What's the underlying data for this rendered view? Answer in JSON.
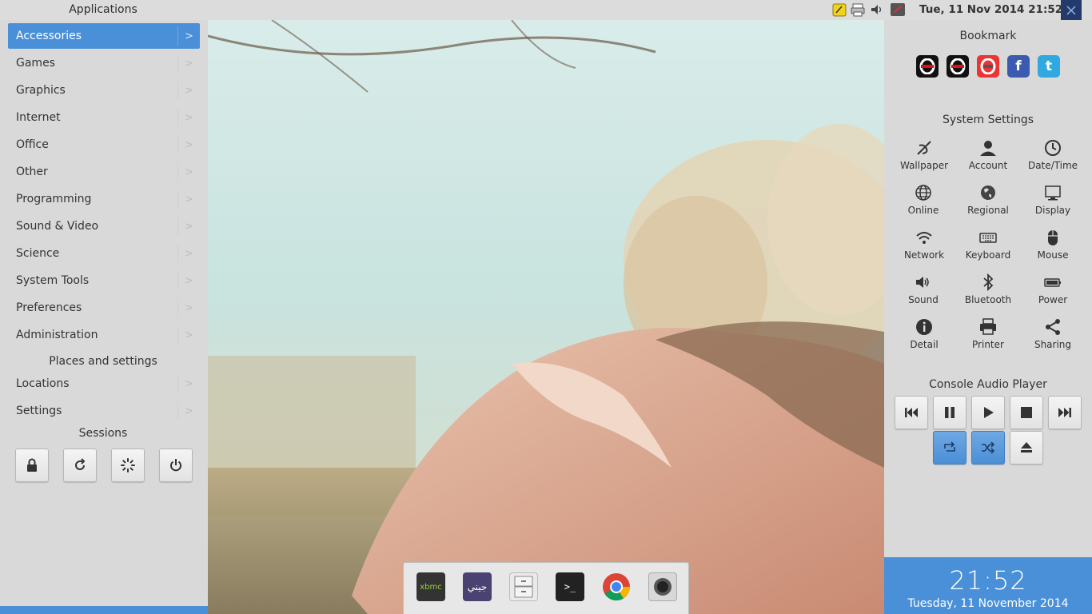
{
  "topbar": {
    "apps_title": "Applications",
    "clock": "Tue, 11 Nov 2014 21:52",
    "tray_icons": [
      "notes-icon",
      "printer-icon",
      "volume-icon",
      "network-icon"
    ]
  },
  "leftmenu": {
    "categories": [
      {
        "label": "Accessories"
      },
      {
        "label": "Games"
      },
      {
        "label": "Graphics"
      },
      {
        "label": "Internet"
      },
      {
        "label": "Office"
      },
      {
        "label": "Other"
      },
      {
        "label": "Programming"
      },
      {
        "label": "Sound & Video"
      },
      {
        "label": "Science"
      },
      {
        "label": "System Tools"
      },
      {
        "label": "Preferences"
      },
      {
        "label": "Administration"
      }
    ],
    "places_title": "Places and settings",
    "places": [
      {
        "label": "Locations"
      },
      {
        "label": "Settings"
      }
    ],
    "sessions_title": "Sessions",
    "sessions": [
      "lock-icon",
      "restart-icon",
      "suspend-icon",
      "power-icon"
    ]
  },
  "dock": {
    "items": [
      "xbmc",
      "arabic-app",
      "file-cabinet",
      "terminal",
      "chrome",
      "camera"
    ],
    "xbmc_label": "xbmc",
    "terminal_label": ">_",
    "arabic_label": "جيني"
  },
  "rightpanel": {
    "bookmark_title": "Bookmark",
    "bookmarks": [
      "opera",
      "opera",
      "opera-alt",
      "facebook",
      "twitter"
    ],
    "facebook_glyph": "f",
    "twitter_glyph": "t",
    "settings_title": "System Settings",
    "settings": [
      {
        "label": "Wallpaper",
        "icon": "wallpaper-icon"
      },
      {
        "label": "Account",
        "icon": "account-icon"
      },
      {
        "label": "Date/Time",
        "icon": "clock-icon"
      },
      {
        "label": "Online",
        "icon": "globe-icon"
      },
      {
        "label": "Regional",
        "icon": "regional-icon"
      },
      {
        "label": "Display",
        "icon": "display-icon"
      },
      {
        "label": "Network",
        "icon": "wifi-icon"
      },
      {
        "label": "Keyboard",
        "icon": "keyboard-icon"
      },
      {
        "label": "Mouse",
        "icon": "mouse-icon"
      },
      {
        "label": "Sound",
        "icon": "speaker-icon"
      },
      {
        "label": "Bluetooth",
        "icon": "bluetooth-icon"
      },
      {
        "label": "Power",
        "icon": "battery-icon"
      },
      {
        "label": "Detail",
        "icon": "info-icon"
      },
      {
        "label": "Printer",
        "icon": "printer-icon"
      },
      {
        "label": "Sharing",
        "icon": "share-icon"
      }
    ],
    "player_title": "Console Audio Player",
    "big_time": "21:52",
    "big_date": "Tuesday, 11 November 2014"
  },
  "colors": {
    "accent": "#4a90d9",
    "panel_bg": "#d9d9d9"
  }
}
